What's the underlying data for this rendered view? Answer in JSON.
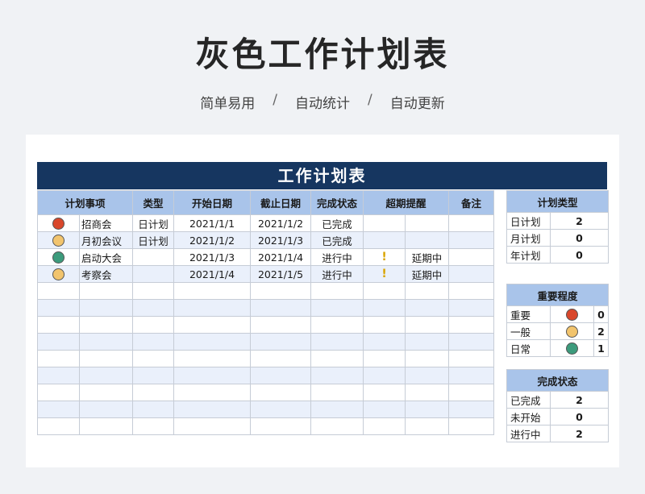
{
  "title": "灰色工作计划表",
  "subtitle": [
    "简单易用",
    "自动统计",
    "自动更新"
  ],
  "subtitle_sep": "/",
  "banner": "工作计划表",
  "main_table": {
    "headers": [
      "计划事项",
      "类型",
      "开始日期",
      "截止日期",
      "完成状态",
      "超期提醒",
      "备注"
    ],
    "rows": [
      {
        "dot": "#d9472b",
        "item": "招商会",
        "type": "日计划",
        "start": "2021/1/1",
        "end": "2021/1/2",
        "status": "已完成",
        "warn": "",
        "overdue": ""
      },
      {
        "dot": "#f2c46d",
        "item": "月初会议",
        "type": "日计划",
        "start": "2021/1/2",
        "end": "2021/1/3",
        "status": "已完成",
        "warn": "",
        "overdue": ""
      },
      {
        "dot": "#3c9b7c",
        "item": "启动大会",
        "type": "",
        "start": "2021/1/3",
        "end": "2021/1/4",
        "status": "进行中",
        "warn": "!",
        "overdue": "延期中"
      },
      {
        "dot": "#f2c46d",
        "item": "考察会",
        "type": "",
        "start": "2021/1/4",
        "end": "2021/1/5",
        "status": "进行中",
        "warn": "!",
        "overdue": "延期中"
      }
    ],
    "empty_rows": 9
  },
  "plan_type": {
    "header": "计划类型",
    "rows": [
      {
        "label": "日计划",
        "value": "2"
      },
      {
        "label": "月计划",
        "value": "0"
      },
      {
        "label": "年计划",
        "value": "0"
      }
    ]
  },
  "importance": {
    "header": "重要程度",
    "rows": [
      {
        "label": "重要",
        "dot": "#d9472b",
        "value": "0"
      },
      {
        "label": "一般",
        "dot": "#f2c46d",
        "value": "2"
      },
      {
        "label": "日常",
        "dot": "#3c9b7c",
        "value": "1"
      }
    ]
  },
  "completion": {
    "header": "完成状态",
    "rows": [
      {
        "label": "已完成",
        "value": "2"
      },
      {
        "label": "未开始",
        "value": "0"
      },
      {
        "label": "进行中",
        "value": "2"
      }
    ]
  }
}
